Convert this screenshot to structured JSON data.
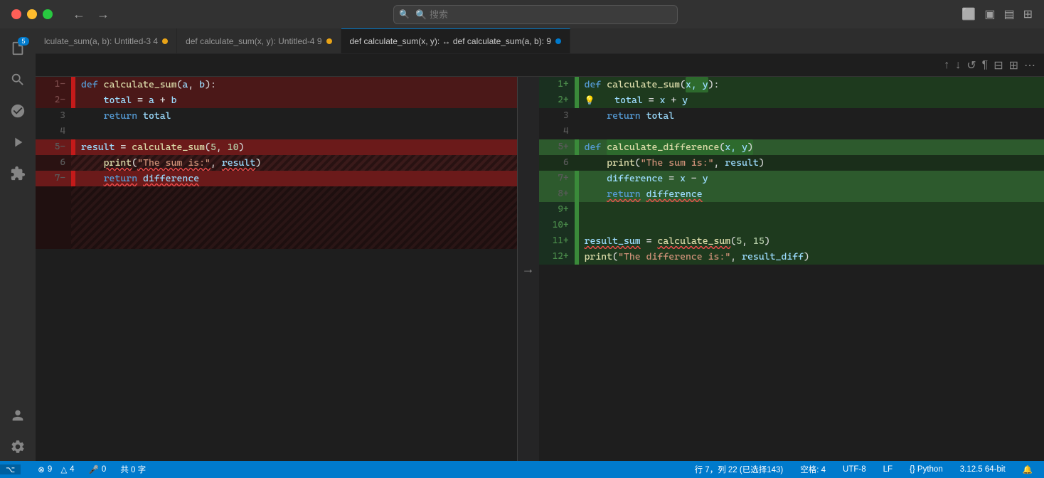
{
  "titlebar": {
    "traffic_lights": [
      "red",
      "yellow",
      "green"
    ],
    "nav_back": "←",
    "nav_forward": "→",
    "search_placeholder": "🔍 搜索"
  },
  "tabs": [
    {
      "label": "lculate_sum(a, b):",
      "file": "Untitled-3",
      "number": "4",
      "dot_color": "orange",
      "active": false
    },
    {
      "label": "def calculate_sum(x, y):",
      "file": "Untitled-4",
      "number": "9",
      "dot_color": "orange",
      "active": false
    },
    {
      "label": "def calculate_sum(x, y): ↔ def calculate_sum(a, b):",
      "number": "9",
      "dot_color": "blue",
      "active": true
    }
  ],
  "left_editor": {
    "lines": [
      {
        "num": "1−",
        "content": "def calculate_sum(a, b):",
        "type": "removed"
      },
      {
        "num": "2−",
        "content": "    total = a + b",
        "type": "removed"
      },
      {
        "num": "3",
        "content": "    return total",
        "type": "normal"
      },
      {
        "num": "4",
        "content": "",
        "type": "normal"
      },
      {
        "num": "5−",
        "content": "result = calculate_sum(5, 10)",
        "type": "removed-bright"
      },
      {
        "num": "6",
        "content": "    print(\"The sum is:\", result)",
        "type": "hatch"
      },
      {
        "num": "7−",
        "content": "    return difference",
        "type": "removed-bright"
      },
      {
        "num": "",
        "content": "",
        "type": "hatch-extra"
      }
    ]
  },
  "right_editor": {
    "lines": [
      {
        "num": "1+",
        "content": "def calculate_sum(x, y):",
        "type": "added",
        "highlight": "x, y"
      },
      {
        "num": "2+",
        "content": "    total = x + y",
        "type": "added",
        "bulb": true
      },
      {
        "num": "3",
        "content": "    return total",
        "type": "normal"
      },
      {
        "num": "4",
        "content": "",
        "type": "normal"
      },
      {
        "num": "5+",
        "content": "def calculate_difference(x, y)",
        "type": "added-bright"
      },
      {
        "num": "6",
        "content": "    print(\"The sum is:\", result)",
        "type": "normal-dark"
      },
      {
        "num": "7+",
        "content": "    difference = x − y",
        "type": "added-bright"
      },
      {
        "num": "8+",
        "content": "    return difference",
        "type": "added-bright"
      },
      {
        "num": "9+",
        "content": "",
        "type": "added"
      },
      {
        "num": "10+",
        "content": "",
        "type": "added"
      },
      {
        "num": "11+",
        "content": "result_sum = calculate_sum(5, 15)",
        "type": "added"
      },
      {
        "num": "12+",
        "content": "print(\"The difference is:\", result_diff)",
        "type": "added"
      }
    ]
  },
  "toolbar_icons": [
    "↑",
    "↓",
    "↺",
    "¶",
    "⊞",
    "⊟",
    "⋯"
  ],
  "status_bar": {
    "remote": "⌥",
    "errors": "⊗ 9",
    "error_count": "9",
    "warnings": "△ 4",
    "warning_count": "4",
    "microphone": "🎤 0",
    "chars": "共 0 字",
    "position": "行 7，列 22 (已选择143)",
    "spaces": "空格: 4",
    "encoding": "UTF-8",
    "line_ending": "LF",
    "language": "{} Python",
    "version": "3.12.5 64-bit",
    "bell": "🔔"
  }
}
